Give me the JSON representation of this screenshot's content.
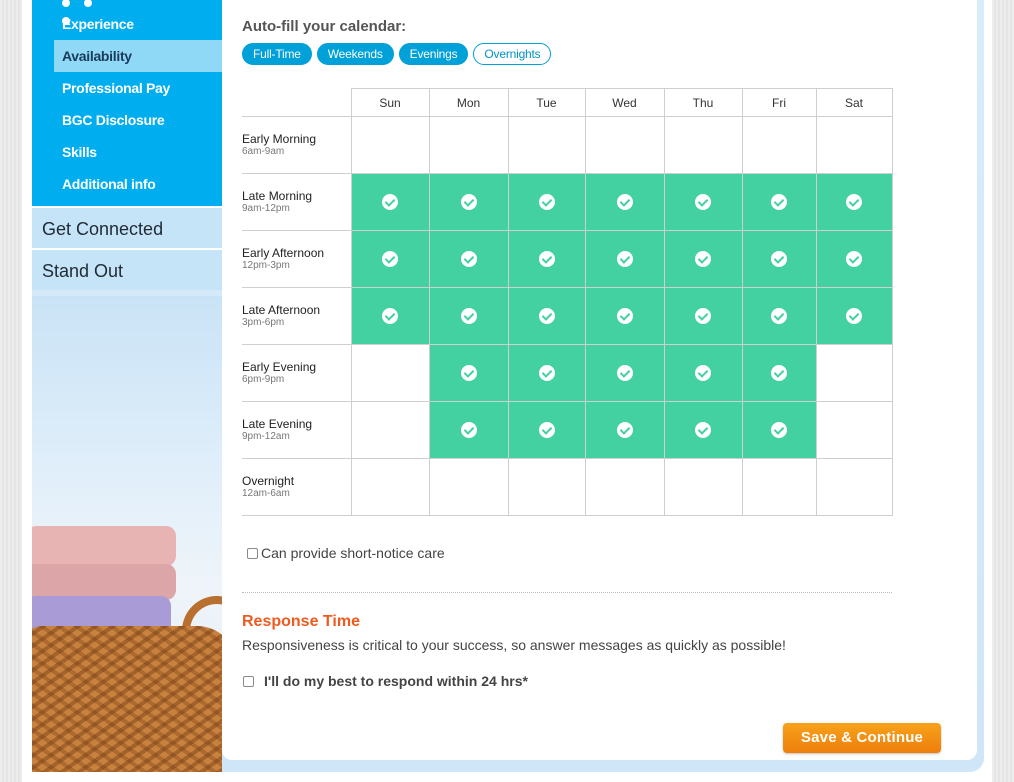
{
  "sidebar": {
    "subnav": [
      "Experience",
      "Availability",
      "Professional Pay",
      "BGC Disclosure",
      "Skills",
      "Additional info"
    ],
    "active_index": 1,
    "main": [
      "Get Connected",
      "Stand Out"
    ]
  },
  "autofill": {
    "title": "Auto-fill your calendar:",
    "pills": [
      "Full-Time",
      "Weekends",
      "Evenings",
      "Overnights"
    ]
  },
  "calendar": {
    "days": [
      "Sun",
      "Mon",
      "Tue",
      "Wed",
      "Thu",
      "Fri",
      "Sat"
    ],
    "slots": [
      {
        "label": "Early Morning",
        "time": "6am-9am",
        "avail": [
          false,
          false,
          false,
          false,
          false,
          false,
          false
        ]
      },
      {
        "label": "Late Morning",
        "time": "9am-12pm",
        "avail": [
          true,
          true,
          true,
          true,
          true,
          true,
          true
        ]
      },
      {
        "label": "Early Afternoon",
        "time": "12pm-3pm",
        "avail": [
          true,
          true,
          true,
          true,
          true,
          true,
          true
        ]
      },
      {
        "label": "Late Afternoon",
        "time": "3pm-6pm",
        "avail": [
          true,
          true,
          true,
          true,
          true,
          true,
          true
        ]
      },
      {
        "label": "Early Evening",
        "time": "6pm-9pm",
        "avail": [
          false,
          true,
          true,
          true,
          true,
          true,
          false
        ]
      },
      {
        "label": "Late Evening",
        "time": "9pm-12am",
        "avail": [
          false,
          true,
          true,
          true,
          true,
          true,
          false
        ]
      },
      {
        "label": "Overnight",
        "time": "12am-6am",
        "avail": [
          false,
          false,
          false,
          false,
          false,
          false,
          false
        ]
      }
    ]
  },
  "short_notice": {
    "label": "Can provide short-notice care",
    "checked": false
  },
  "response": {
    "title": "Response Time",
    "text": "Responsiveness is critical to your success, so answer messages as quickly as possible!",
    "checkbox_label": "I'll do my best to respond within 24 hrs*",
    "checked": false
  },
  "actions": {
    "save_label": "Save & Continue"
  },
  "colors": {
    "available": "#44d1a1",
    "subnav": "#00aeef",
    "accent": "#f05a1e",
    "button": "#f7941d"
  }
}
